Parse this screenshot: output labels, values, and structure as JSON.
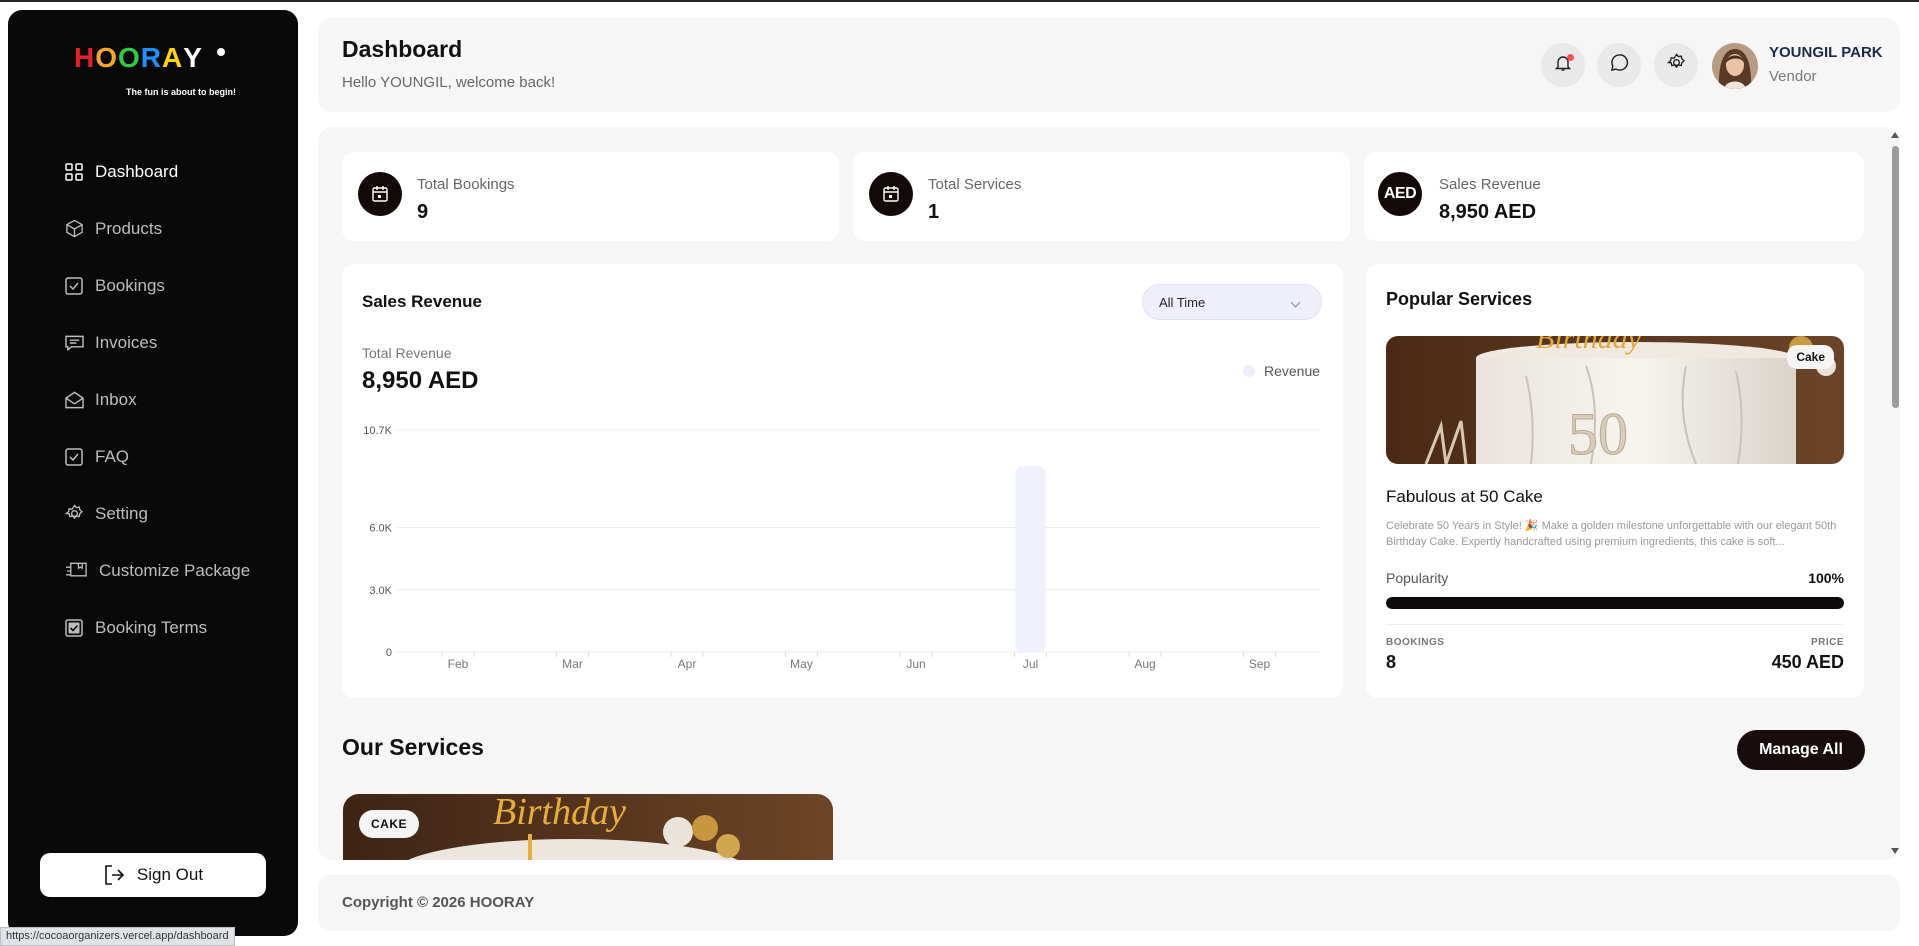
{
  "brand": {
    "logo_letters": [
      "H",
      "O",
      "O",
      "R",
      "A",
      "Y"
    ],
    "logo_colors": [
      "#e8202a",
      "#f5a623",
      "#2ecc40",
      "#1e90ff",
      "#ffd400",
      "#ffffff"
    ],
    "tagline": "The fun is about to begin!"
  },
  "sidebar": {
    "items": [
      {
        "label": "Dashboard",
        "icon": "grid-icon",
        "active": true
      },
      {
        "label": "Products",
        "icon": "box-icon"
      },
      {
        "label": "Bookings",
        "icon": "checkbox-icon"
      },
      {
        "label": "Invoices",
        "icon": "message-lines-icon"
      },
      {
        "label": "Inbox",
        "icon": "envelope-open-icon"
      },
      {
        "label": "FAQ",
        "icon": "checkbox-icon"
      },
      {
        "label": "Setting",
        "icon": "gear-icon"
      },
      {
        "label": "Customize Package",
        "icon": "package-icon"
      },
      {
        "label": "Booking Terms",
        "icon": "checkbox-filled-icon"
      }
    ],
    "signout_label": "Sign Out"
  },
  "status_url": "https://cocoaorganizers.vercel.app/dashboard",
  "header": {
    "title": "Dashboard",
    "subtitle": "Hello YOUNGIL, welcome back!",
    "user_name": "YOUNGIL PARK",
    "user_role": "Vendor"
  },
  "stats": [
    {
      "label": "Total Bookings",
      "value": "9",
      "icon": "calendar-icon"
    },
    {
      "label": "Total Services",
      "value": "1",
      "icon": "calendar-icon"
    },
    {
      "label": "Sales Revenue",
      "value": "8,950 AED",
      "icon_text": "AED"
    }
  ],
  "revenue": {
    "title": "Sales Revenue",
    "filter_value": "All Time",
    "total_label": "Total Revenue",
    "total_value": "8,950 AED",
    "legend": "Revenue"
  },
  "chart_data": {
    "type": "bar",
    "title": "",
    "categories": [
      "Feb",
      "Mar",
      "Apr",
      "May",
      "Jun",
      "Jul",
      "Aug",
      "Sep"
    ],
    "series": [
      {
        "name": "Revenue",
        "values": [
          0,
          0,
          0,
          0,
          0,
          8950,
          0,
          0
        ]
      }
    ],
    "y_ticks": [
      0,
      3000,
      6000,
      10700
    ],
    "y_tick_labels": [
      "0",
      "3.0K",
      "6.0K",
      "10.7K"
    ],
    "ylim": [
      0,
      10700
    ],
    "grid": true,
    "bar_color": "#eef0fc",
    "legend_position": "top-right"
  },
  "popular": {
    "title": "Popular Services",
    "badge": "Cake",
    "name": "Fabulous at 50 Cake",
    "description": "Celebrate 50 Years in Style! 🎉 Make a golden milestone unforgettable with our elegant 50th Birthday Cake. Expertly handcrafted using premium ingredients, this cake is soft...",
    "popularity_label": "Popularity",
    "popularity_value": "100%",
    "popularity_fraction": 1.0,
    "bookings_label": "BOOKINGS",
    "bookings_value": "8",
    "price_label": "PRICE",
    "price_value": "450 AED"
  },
  "services": {
    "title": "Our Services",
    "manage_label": "Manage All",
    "card_badge": "CAKE"
  },
  "footer": {
    "copyright": "Copyright © 2026 HOORAY"
  }
}
